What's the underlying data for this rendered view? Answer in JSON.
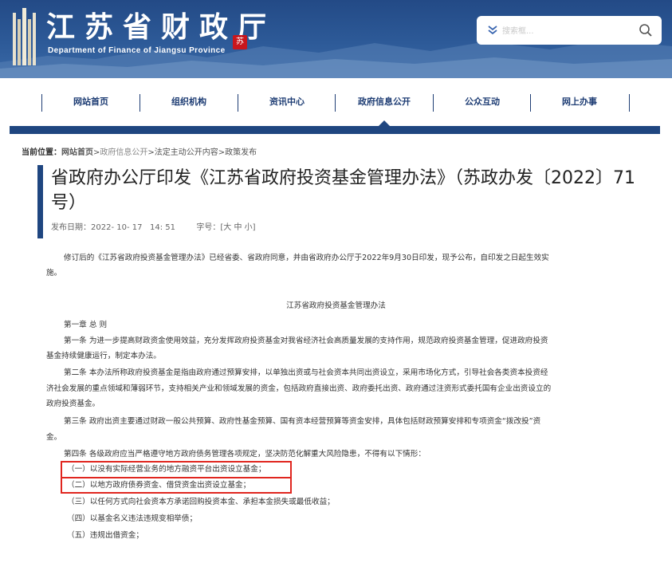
{
  "header": {
    "title": "江苏省财政厅",
    "subtitle": "Department of Finance of Jiangsu Province",
    "seal_text": "苏",
    "search_placeholder": "搜索框..."
  },
  "nav": {
    "items": [
      "网站首页",
      "组织机构",
      "资讯中心",
      "政府信息公开",
      "公众互动",
      "网上办事"
    ]
  },
  "breadcrumb": {
    "label": "当前位置：",
    "home": "网站首页",
    "sep": ">",
    "l2": "政府信息公开",
    "l3": "法定主动公开内容",
    "l4": "政策发布"
  },
  "article": {
    "title": "省政府办公厅印发《江苏省政府投资基金管理办法》（苏政办发〔2022〕71号）",
    "date_label": "发布日期：",
    "date": "2022- 10- 17   14: 51",
    "font_label": "字号：[",
    "font_large": "大",
    "font_mid": "中",
    "font_small": "小",
    "font_close": "]",
    "intro_line1": "修订后的《江苏省政府投资基金管理办法》已经省委、省政府同意，并由省政府办公厅于2022年9月30日印发，现予公布，自印发之日起生效实",
    "intro_line2": "施。",
    "doc_title": "江苏省政府投资基金管理办法",
    "chapter": "第一章  总  则",
    "art1_line1": "第一条  为进一步提高财政资金使用效益，充分发挥政府投资基金对我省经济社会高质量发展的支持作用，规范政府投资基金管理，促进政府投资",
    "art1_line2": "基金持续健康运行，制定本办法。",
    "art2_line1": "第二条  本办法所称政府投资基金是指由政府通过预算安排，以单独出资或与社会资本共同出资设立，采用市场化方式，引导社会各类资本投资经",
    "art2_line2": "济社会发展的重点领域和薄弱环节，支持相关产业和领域发展的资金，包括政府直接出资、政府委托出资、政府通过注资形式委托国有企业出资设立的",
    "art2_line3": "政府投资基金。",
    "art3_line1": "第三条  政府出资主要通过财政一般公共预算、政府性基金预算、国有资本经营预算等资金安排，具体包括财政预算安排和专项资金“拨改投”资",
    "art3_line2": "金。",
    "art4": "第四条   各级政府应当严格遵守地方政府债务管理各项规定，坚决防范化解重大风险隐患，不得有以下情形：",
    "item1": "（一）以没有实际经营业务的地方融资平台出资设立基金；",
    "item2": "（二）以地方政府债券资金、借贷资金出资设立基金；",
    "item3": "（三）以任何方式向社会资本方承诺回购投资本金、承担本金损失或最低收益；",
    "item4": "（四）以基金名义违法违规变相举债；",
    "item5": "（五）违规出借资金；"
  },
  "colors": {
    "brand_blue": "#1f4680",
    "highlight_red": "#e0261f"
  }
}
